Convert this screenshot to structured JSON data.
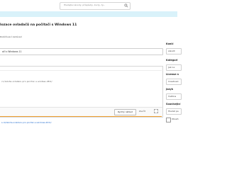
{
  "header": {
    "search_placeholder": "Hledejte návody, příspěvky, kurzy, ty..."
  },
  "page": {
    "title": "Zálohování ovladačů na počítači s Windows 11",
    "title_display": "lozace ovladačů na počítači s Windows 11",
    "edit_summary_label": "Rozšiřovací zadávací"
  },
  "form": {
    "title_value": "ači s Windows 11",
    "code_line": "ci/zaloha-ovladacu-pro-pocitac-s-windows-2011/",
    "preview_button": "Rychlý náhled",
    "close_tab": "Zavřít",
    "bottom_link": "s.cz/zaloha-ovladacu-pro-pocitac-s-windows-2011/"
  },
  "sidebar": {
    "fields": [
      {
        "label": "Konić",
        "value": "zalozit"
      },
      {
        "label": "Kategori",
        "value": "Jak na"
      },
      {
        "label": "License n",
        "value": "CreativeC"
      },
      {
        "label": "Jazyk",
        "value": "Čeština"
      },
      {
        "label": "Související",
        "value": "Hledat pa"
      }
    ],
    "checkbox_label": "Obsah"
  }
}
